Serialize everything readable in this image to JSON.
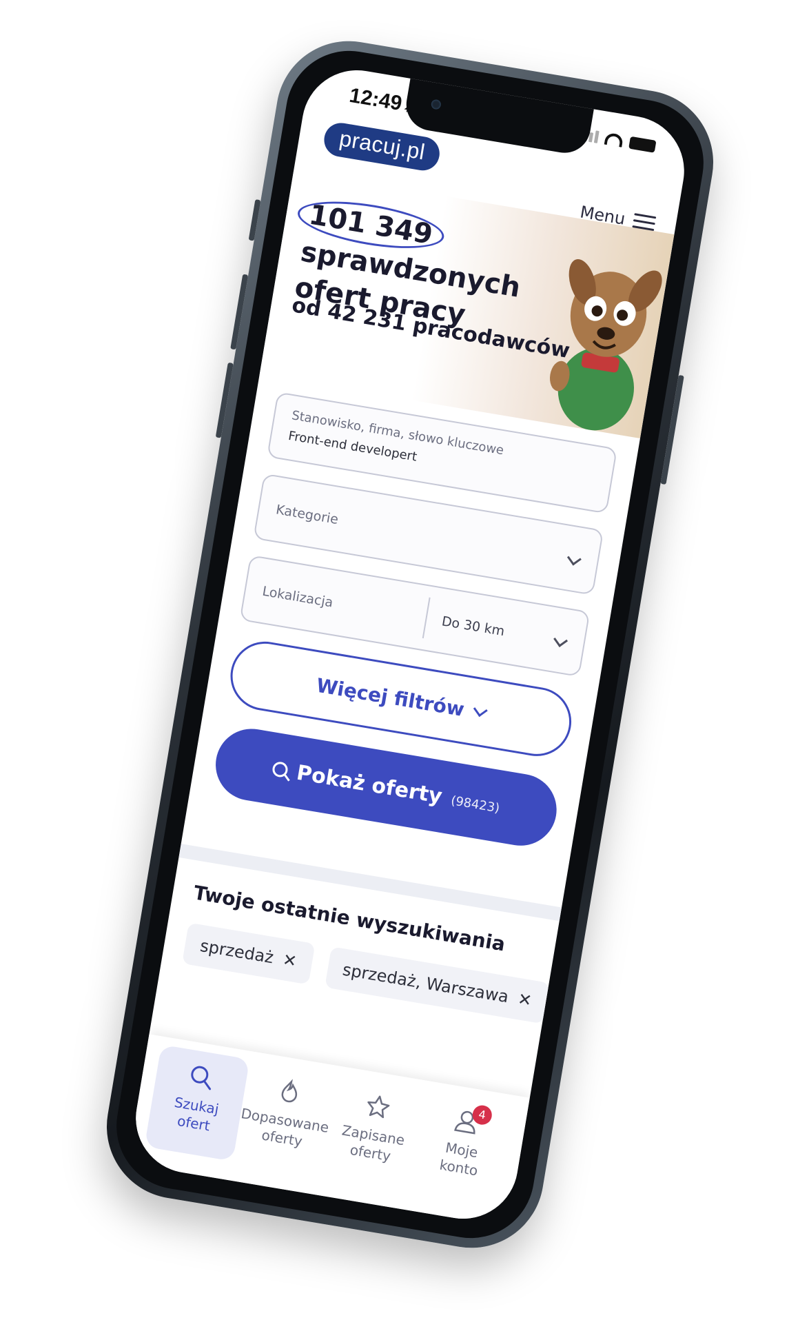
{
  "status_bar": {
    "time": "12:49",
    "location_arrow": "➶"
  },
  "header": {
    "logo": "pracuj.pl",
    "menu_label": "Menu"
  },
  "hero": {
    "offers_count": "101 349",
    "title_rest_line1": "sprawdzonych",
    "title_line2": "ofert pracy",
    "subtitle": "od 42 231 pracodawców"
  },
  "search_form": {
    "position_field": {
      "label": "Stanowisko, firma, słowo kluczowe",
      "value": "Front-end developert"
    },
    "category_field": {
      "placeholder": "Kategorie"
    },
    "location_field": {
      "placeholder": "Lokalizacja"
    },
    "radius_field": {
      "value": "Do 30 km"
    },
    "more_filters_label": "Więcej filtrów",
    "show_offers_label": "Pokaż oferty",
    "show_offers_count": "(98423)"
  },
  "recent_searches": {
    "title": "Twoje ostatnie wyszukiwania",
    "items": [
      {
        "label": "sprzedaż",
        "remove": "✕"
      },
      {
        "label": "sprzedaż, Warszawa",
        "remove": "✕"
      }
    ]
  },
  "bottom_nav": {
    "items": [
      {
        "label_line1": "Szukaj",
        "label_line2": "ofert",
        "icon": "search-icon",
        "active": true
      },
      {
        "label_line1": "Dopasowane",
        "label_line2": "oferty",
        "icon": "matched-offers-icon",
        "active": false
      },
      {
        "label_line1": "Zapisane",
        "label_line2": "oferty",
        "icon": "star-icon",
        "active": false
      },
      {
        "label_line1": "Moje",
        "label_line2": "konto",
        "icon": "user-icon",
        "active": false,
        "badge": "4"
      }
    ]
  },
  "colors": {
    "brand": "#3d4bbf",
    "logo_bg": "#1f3b84",
    "badge": "#d6304a",
    "text_dark": "#1a1a2e"
  }
}
